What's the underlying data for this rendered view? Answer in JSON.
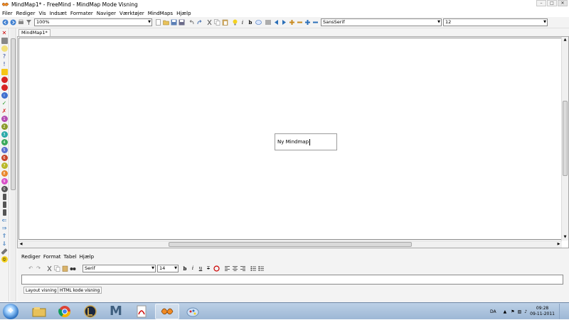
{
  "window": {
    "title": "MindMap1* - FreeMind - MindMap Mode Visning",
    "minimize_icon": "minimize-icon",
    "maximize_icon": "maximize-icon",
    "close_icon": "close-icon"
  },
  "menubar": {
    "items": [
      "Filer",
      "Rediger",
      "Vis",
      "Indsæt",
      "Formater",
      "Naviger",
      "Værktøjer",
      "MindMaps",
      "Hjælp"
    ]
  },
  "toolbar": {
    "zoom": "100%",
    "font_family": "SansSerif",
    "font_size": "12"
  },
  "tabs": {
    "map_tab": "MindMap1*"
  },
  "canvas": {
    "root_node_text": "Ny Mindmap"
  },
  "notes": {
    "menu": [
      "Rediger",
      "Format",
      "Tabel",
      "Hjælp"
    ],
    "font_family": "Serif",
    "font_size": "14",
    "tab_layout": "Layout visning",
    "tab_html": "HTML kode visning"
  },
  "taskbar": {
    "language": "DA",
    "time": "09:28",
    "date": "09-11-2011"
  },
  "colors": {
    "accent": "#2b6fb8",
    "taskbar": "#a9c1dc",
    "toolbar": "#f3f3f3"
  }
}
